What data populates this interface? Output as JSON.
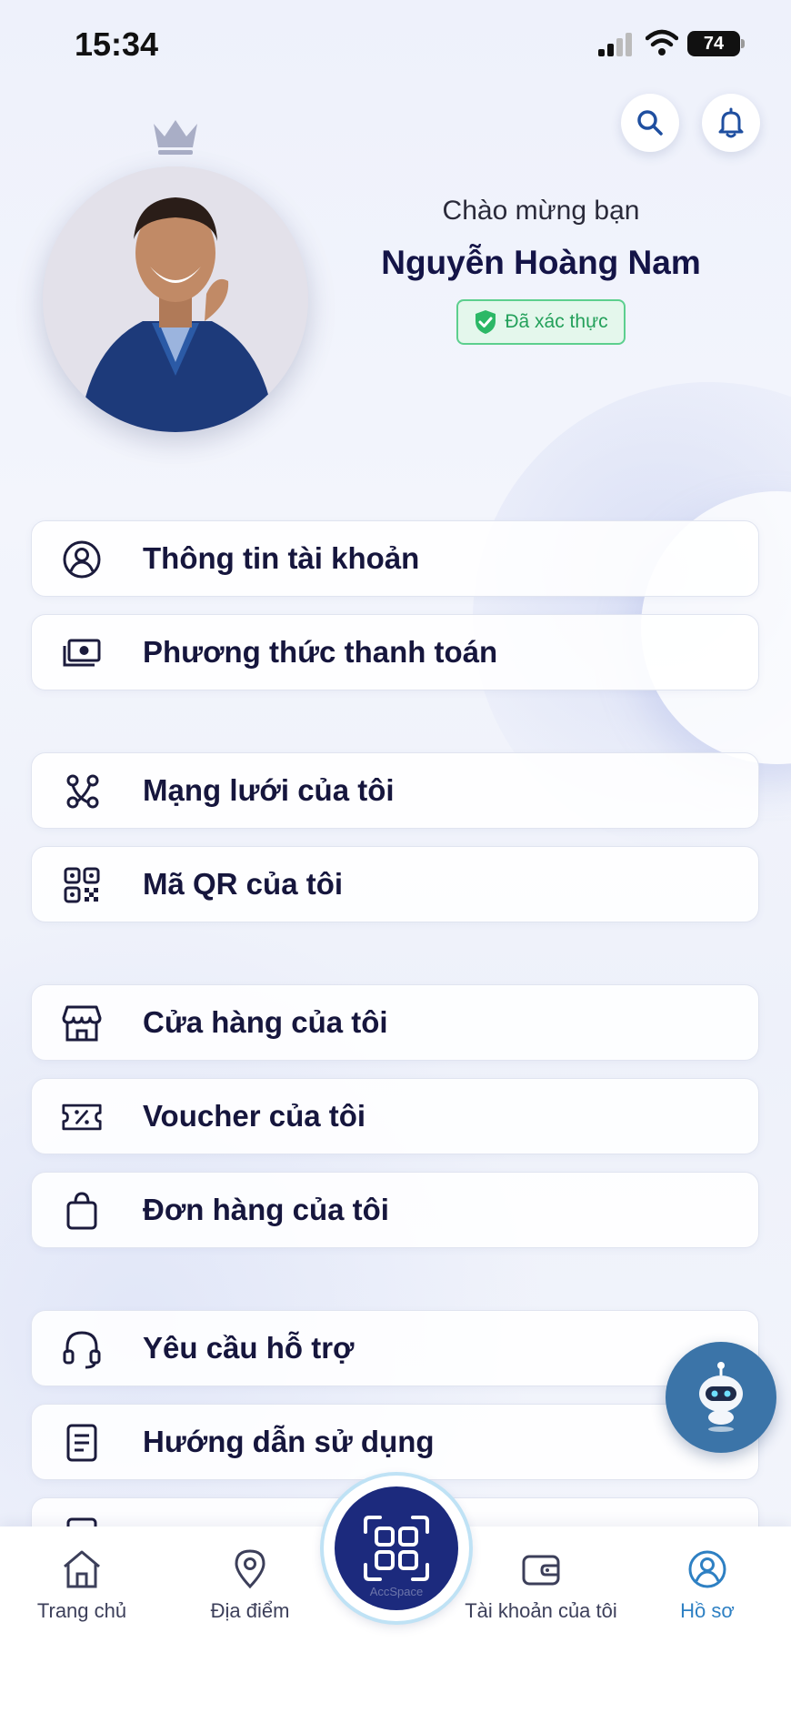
{
  "status_bar": {
    "time": "15:34",
    "battery": "74"
  },
  "profile": {
    "greeting": "Chào mừng bạn",
    "name": "Nguyễn Hoàng Nam",
    "verified_label": "Đã xác thực"
  },
  "menu": {
    "account_info": "Thông tin tài khoản",
    "payment_method": "Phương thức thanh toán",
    "my_network": "Mạng lưới của tôi",
    "my_qr": "Mã QR của tôi",
    "my_store": "Cửa hàng của tôi",
    "my_voucher": "Voucher của tôi",
    "my_orders": "Đơn hàng của tôi",
    "support_request": "Yêu cầu hỗ trợ",
    "user_guide": "Hướng dẫn sử dụng"
  },
  "nav": {
    "home": "Trang chủ",
    "places": "Địa điểm",
    "scan_caption": "AccSpace",
    "my_account": "Tài khoản của tôi",
    "profile": "Hồ sơ"
  },
  "colors": {
    "primary_dark": "#1c2a7d",
    "active_blue": "#2e80c3",
    "verified_green": "#23a05a",
    "chatbot_blue": "#3b74a8"
  }
}
